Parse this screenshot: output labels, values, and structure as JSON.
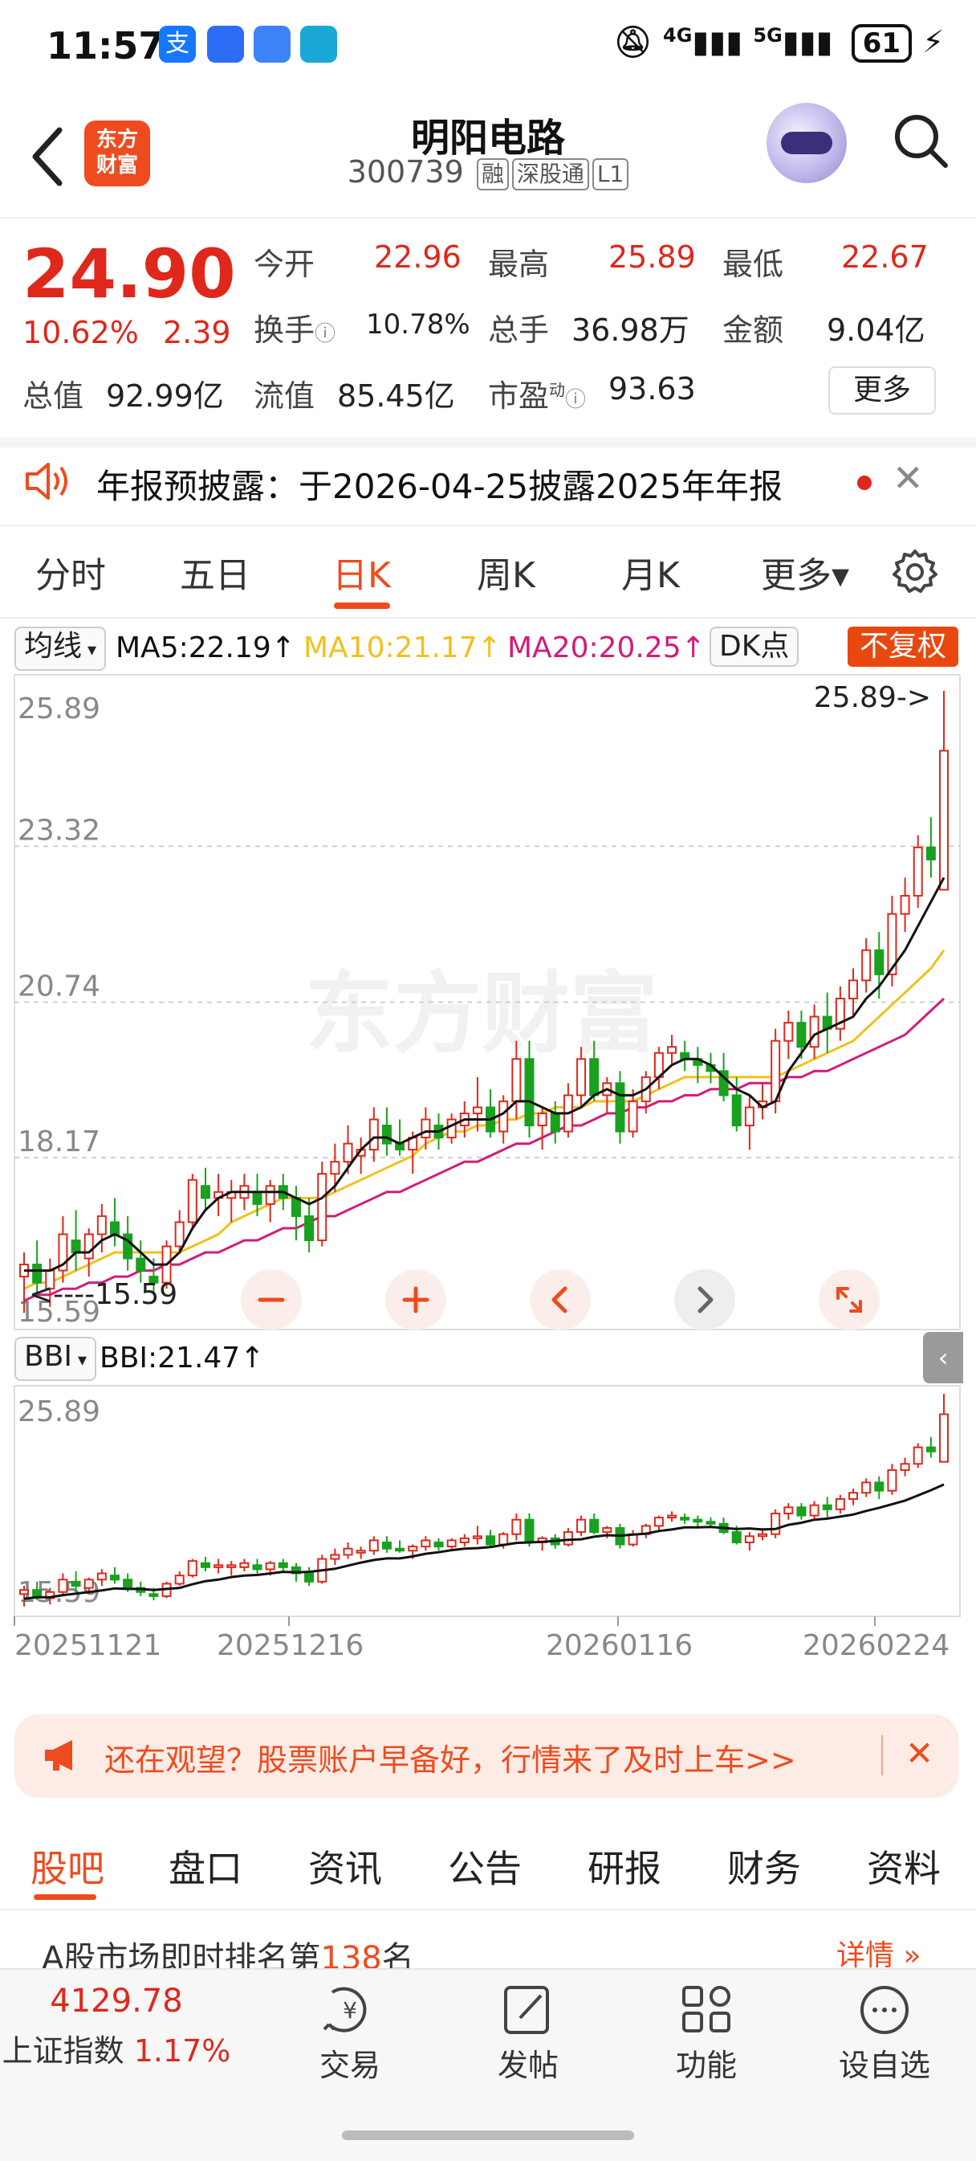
{
  "status_bar": {
    "time": "11:57",
    "signal1": "4G",
    "signal2": "5G",
    "battery": "61"
  },
  "header": {
    "back_icon": "chevron-left-icon",
    "logo_line1": "东方",
    "logo_line2": "财富",
    "title": "明阳电路",
    "code": "300739",
    "tags": [
      "融",
      "深股通",
      "L1"
    ],
    "search_icon": "search-icon"
  },
  "quote": {
    "price": "24.90",
    "change_pct": "10.62%",
    "change_amt": "2.39",
    "open_label": "今开",
    "open": "22.96",
    "high_label": "最高",
    "high": "25.89",
    "low_label": "最低",
    "low": "22.67",
    "turnover_label": "换手",
    "turnover": "10.78%",
    "volume_label": "总手",
    "volume": "36.98万",
    "amount_label": "金额",
    "amount": "9.04亿",
    "mktcap_label": "总值",
    "mktcap": "92.99亿",
    "float_label": "流值",
    "float": "85.45亿",
    "pe_label": "市盈",
    "pe_sup": "动",
    "pe": "93.63",
    "more": "更多"
  },
  "notice": {
    "text": "年报预披露：于2026-04-25披露2025年年报"
  },
  "ktabs": [
    "分时",
    "五日",
    "日K",
    "周K",
    "月K",
    "更多▾"
  ],
  "indicators": {
    "main_select": "均线",
    "ma5": "MA5:22.19↑",
    "ma10": "MA10:21.17↑",
    "ma20": "MA20:20.25↑",
    "dk": "DK点",
    "adjust": "不复权",
    "sub_select": "BBI",
    "bbi": "BBI:21.47↑"
  },
  "chart_data": {
    "type": "candlestick",
    "y_ticks": [
      "25.89",
      "23.32",
      "20.74",
      "18.17",
      "15.59"
    ],
    "ylim": [
      15.59,
      25.89
    ],
    "max_label": "25.89->",
    "min_label": "<----15.59",
    "sub_y_ticks": [
      "25.89",
      "15.59"
    ],
    "dates": [
      "20251121",
      "20251216",
      "20260116",
      "20260224"
    ],
    "watermark": "东方财富",
    "colors": {
      "up": "#e0271b",
      "down": "#19a11f",
      "ma5": "#111111",
      "ma10": "#f2c01e",
      "ma20": "#d21c7a",
      "bbi": "#111111"
    },
    "candles": [
      [
        16.2,
        16.6,
        15.6,
        16.4
      ],
      [
        16.4,
        16.8,
        15.9,
        16.1
      ],
      [
        16.0,
        16.5,
        15.7,
        16.3
      ],
      [
        16.3,
        17.2,
        16.1,
        16.9
      ],
      [
        16.8,
        17.3,
        16.3,
        16.6
      ],
      [
        16.5,
        17.0,
        16.2,
        16.9
      ],
      [
        16.9,
        17.4,
        16.6,
        17.2
      ],
      [
        17.1,
        17.5,
        16.7,
        16.9
      ],
      [
        16.9,
        17.2,
        16.3,
        16.5
      ],
      [
        16.5,
        16.8,
        16.1,
        16.3
      ],
      [
        16.2,
        16.5,
        15.9,
        16.1
      ],
      [
        16.1,
        16.8,
        16.0,
        16.7
      ],
      [
        16.7,
        17.3,
        16.6,
        17.1
      ],
      [
        17.1,
        17.9,
        17.0,
        17.8
      ],
      [
        17.7,
        18.0,
        17.3,
        17.5
      ],
      [
        17.5,
        17.9,
        17.2,
        17.6
      ],
      [
        17.5,
        17.8,
        17.1,
        17.6
      ],
      [
        17.5,
        17.9,
        17.3,
        17.7
      ],
      [
        17.6,
        17.9,
        17.2,
        17.4
      ],
      [
        17.4,
        17.8,
        17.1,
        17.7
      ],
      [
        17.7,
        17.9,
        17.3,
        17.5
      ],
      [
        17.5,
        17.7,
        16.8,
        17.2
      ],
      [
        17.2,
        17.5,
        16.6,
        16.8
      ],
      [
        16.8,
        18.1,
        16.7,
        17.9
      ],
      [
        17.9,
        18.4,
        17.6,
        18.1
      ],
      [
        18.1,
        18.7,
        17.9,
        18.4
      ],
      [
        18.2,
        18.5,
        17.9,
        18.3
      ],
      [
        18.3,
        19.0,
        18.1,
        18.8
      ],
      [
        18.7,
        19.0,
        18.2,
        18.4
      ],
      [
        18.4,
        18.8,
        18.2,
        18.3
      ],
      [
        18.3,
        18.6,
        17.9,
        18.5
      ],
      [
        18.5,
        19.0,
        18.3,
        18.8
      ],
      [
        18.7,
        18.9,
        18.3,
        18.5
      ],
      [
        18.5,
        18.9,
        18.4,
        18.8
      ],
      [
        18.7,
        19.1,
        18.5,
        18.9
      ],
      [
        18.9,
        19.5,
        18.6,
        19.0
      ],
      [
        19.0,
        19.3,
        18.5,
        18.6
      ],
      [
        18.6,
        19.2,
        18.4,
        19.1
      ],
      [
        19.1,
        20.1,
        18.8,
        19.8
      ],
      [
        19.8,
        20.1,
        18.5,
        18.7
      ],
      [
        18.7,
        19.0,
        18.3,
        18.9
      ],
      [
        18.9,
        19.1,
        18.4,
        18.6
      ],
      [
        18.6,
        19.4,
        18.5,
        19.2
      ],
      [
        19.2,
        20.0,
        19.0,
        19.8
      ],
      [
        19.8,
        20.1,
        19.1,
        19.2
      ],
      [
        19.2,
        19.5,
        18.9,
        19.4
      ],
      [
        19.4,
        19.6,
        18.4,
        18.6
      ],
      [
        18.6,
        19.3,
        18.5,
        19.1
      ],
      [
        19.1,
        19.6,
        18.9,
        19.5
      ],
      [
        19.5,
        20.0,
        19.3,
        19.9
      ],
      [
        19.9,
        20.2,
        19.7,
        20.0
      ],
      [
        19.9,
        20.1,
        19.6,
        19.8
      ],
      [
        19.8,
        20.0,
        19.4,
        19.7
      ],
      [
        19.7,
        19.9,
        19.4,
        19.6
      ],
      [
        19.6,
        19.9,
        19.1,
        19.2
      ],
      [
        19.2,
        19.5,
        18.6,
        18.7
      ],
      [
        18.7,
        19.2,
        18.3,
        19.0
      ],
      [
        19.0,
        19.4,
        18.8,
        19.1
      ],
      [
        19.1,
        20.3,
        18.9,
        20.1
      ],
      [
        20.1,
        20.6,
        19.8,
        20.4
      ],
      [
        20.4,
        20.6,
        19.8,
        20.0
      ],
      [
        20.0,
        20.7,
        19.8,
        20.5
      ],
      [
        20.5,
        20.9,
        19.9,
        20.3
      ],
      [
        20.3,
        21.0,
        20.1,
        20.8
      ],
      [
        20.8,
        21.3,
        20.5,
        21.1
      ],
      [
        21.1,
        21.8,
        20.9,
        21.6
      ],
      [
        21.6,
        21.9,
        20.8,
        21.2
      ],
      [
        21.2,
        22.5,
        21.0,
        22.2
      ],
      [
        22.2,
        22.8,
        21.9,
        22.5
      ],
      [
        22.5,
        23.5,
        22.3,
        23.3
      ],
      [
        23.3,
        23.8,
        22.8,
        23.1
      ],
      [
        22.6,
        25.89,
        22.6,
        24.9
      ]
    ],
    "ma5": [
      16.3,
      16.3,
      16.3,
      16.4,
      16.6,
      16.6,
      16.8,
      16.9,
      16.8,
      16.6,
      16.4,
      16.4,
      16.6,
      17.0,
      17.3,
      17.5,
      17.6,
      17.6,
      17.6,
      17.6,
      17.6,
      17.5,
      17.4,
      17.5,
      17.7,
      18.0,
      18.3,
      18.5,
      18.5,
      18.4,
      18.5,
      18.6,
      18.6,
      18.7,
      18.8,
      18.8,
      18.8,
      18.9,
      19.1,
      19.1,
      19.0,
      18.9,
      18.9,
      19.0,
      19.2,
      19.3,
      19.2,
      19.2,
      19.3,
      19.5,
      19.7,
      19.8,
      19.8,
      19.7,
      19.5,
      19.3,
      19.2,
      19.0,
      19.1,
      19.6,
      19.9,
      20.2,
      20.3,
      20.4,
      20.5,
      20.8,
      21.0,
      21.3,
      21.6,
      22.0,
      22.4,
      22.8
    ],
    "ma10": [
      16.0,
      16.1,
      16.1,
      16.2,
      16.3,
      16.4,
      16.5,
      16.6,
      16.6,
      16.6,
      16.6,
      16.6,
      16.6,
      16.7,
      16.8,
      16.9,
      17.1,
      17.2,
      17.3,
      17.4,
      17.5,
      17.5,
      17.5,
      17.5,
      17.6,
      17.7,
      17.8,
      17.9,
      18.0,
      18.1,
      18.2,
      18.4,
      18.5,
      18.6,
      18.6,
      18.7,
      18.7,
      18.8,
      18.8,
      18.9,
      18.9,
      19.0,
      19.0,
      19.0,
      19.1,
      19.1,
      19.1,
      19.1,
      19.2,
      19.3,
      19.4,
      19.5,
      19.5,
      19.5,
      19.5,
      19.5,
      19.5,
      19.5,
      19.5,
      19.6,
      19.7,
      19.8,
      19.9,
      20.0,
      20.1,
      20.3,
      20.5,
      20.7,
      20.9,
      21.1,
      21.3,
      21.6
    ],
    "ma20": [
      15.8,
      15.9,
      15.9,
      16.0,
      16.0,
      16.1,
      16.1,
      16.2,
      16.2,
      16.3,
      16.3,
      16.4,
      16.4,
      16.5,
      16.6,
      16.6,
      16.7,
      16.8,
      16.8,
      16.9,
      17.0,
      17.0,
      17.1,
      17.2,
      17.2,
      17.3,
      17.4,
      17.5,
      17.6,
      17.6,
      17.7,
      17.8,
      17.9,
      18.0,
      18.1,
      18.1,
      18.2,
      18.3,
      18.4,
      18.4,
      18.5,
      18.6,
      18.7,
      18.7,
      18.8,
      18.9,
      18.9,
      19.0,
      19.0,
      19.1,
      19.1,
      19.2,
      19.2,
      19.3,
      19.3,
      19.3,
      19.4,
      19.4,
      19.4,
      19.5,
      19.5,
      19.6,
      19.6,
      19.7,
      19.8,
      19.9,
      20.0,
      20.1,
      20.2,
      20.4,
      20.6,
      20.8
    ]
  },
  "controls": {
    "minus_icon": "minus-icon",
    "plus_icon": "plus-icon",
    "left_icon": "chevron-left-icon",
    "right_icon": "chevron-right-icon",
    "expand_icon": "expand-icon"
  },
  "banner": {
    "text": "还在观望？股票账户早备好，行情来了及时上车>>"
  },
  "bottom_tabs": [
    "股吧",
    "盘口",
    "资讯",
    "公告",
    "研报",
    "财务",
    "资料"
  ],
  "rank": {
    "prefix": "A股市场即时排名第",
    "num": "138",
    "suffix": "名",
    "detail": "详情"
  },
  "nav": {
    "index_value": "4129.78",
    "index_name": "上证指数",
    "index_change": "1.17%",
    "items": [
      "交易",
      "发帖",
      "功能",
      "设自选"
    ]
  }
}
